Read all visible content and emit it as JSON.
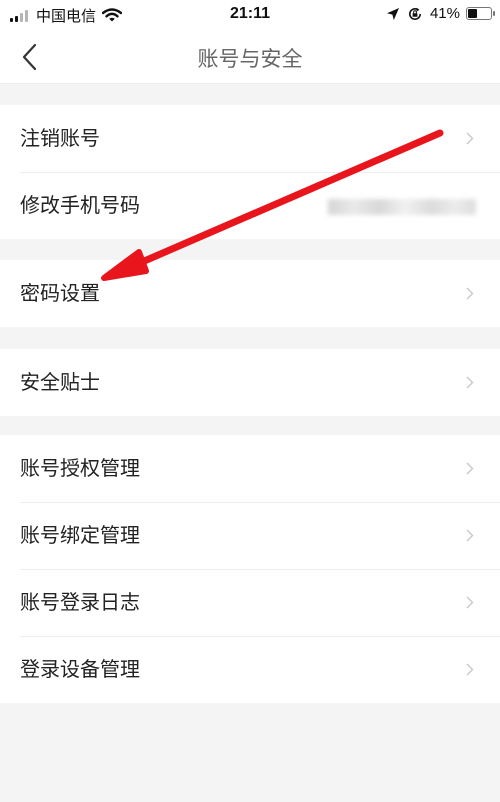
{
  "status_bar": {
    "carrier": "中国电信",
    "time": "21:11",
    "battery": "41%",
    "battery_level": 0.41,
    "icons": [
      "signal-icon",
      "wifi-icon",
      "location-icon",
      "rotation-lock-icon",
      "battery-icon"
    ]
  },
  "nav": {
    "title": "账号与安全",
    "back_icon": "chevron-left-icon"
  },
  "groups": [
    {
      "items": [
        {
          "label": "注销账号"
        },
        {
          "label": "修改手机号码",
          "value_blurred": true
        }
      ]
    },
    {
      "items": [
        {
          "label": "密码设置"
        }
      ]
    },
    {
      "items": [
        {
          "label": "安全贴士"
        }
      ]
    },
    {
      "items": [
        {
          "label": "账号授权管理"
        },
        {
          "label": "账号绑定管理"
        },
        {
          "label": "账号登录日志"
        },
        {
          "label": "登录设备管理"
        }
      ]
    }
  ],
  "annotation": {
    "type": "red-arrow",
    "color": "#e8161c",
    "points_to": "密码设置"
  },
  "colors": {
    "background": "#f4f4f4",
    "row_background": "#ffffff",
    "divider": "#ececec",
    "title_text": "#666666",
    "chevron": "#c8c8c8"
  }
}
